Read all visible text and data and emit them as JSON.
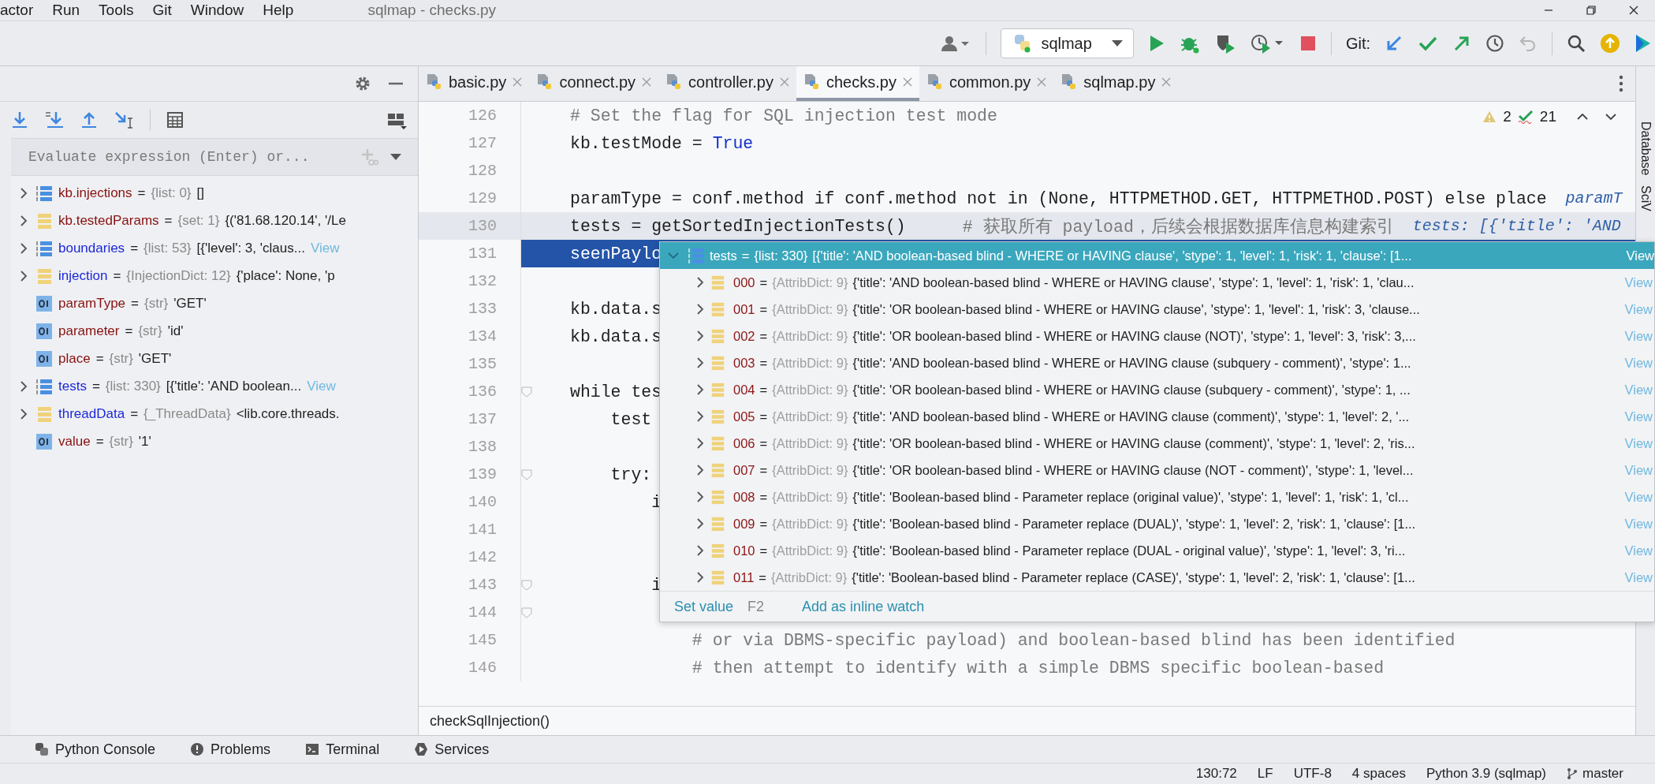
{
  "menu_bar": {
    "items": [
      "actor",
      "Run",
      "Tools",
      "Git",
      "Window",
      "Help"
    ],
    "title": "sqlmap - checks.py"
  },
  "toolbar": {
    "run_config": "sqlmap",
    "git_label": "Git:"
  },
  "debugger": {
    "evaluate_placeholder": "Evaluate expression (Enter) or...",
    "variables": [
      {
        "name": "kb.injections",
        "sep": "=",
        "type": "{list: 0}",
        "value": "[]",
        "kind": "list",
        "expandable": true,
        "changed": false
      },
      {
        "name": "kb.testedParams",
        "sep": "=",
        "type": "{set: 1}",
        "value": "{('81.68.120.14', '/Le",
        "kind": "dict",
        "expandable": true,
        "changed": false
      },
      {
        "name": "boundaries",
        "sep": "=",
        "type": "{list: 53}",
        "value": "[{'level': 3, 'claus...",
        "link": "View",
        "kind": "list",
        "expandable": true,
        "changed": true
      },
      {
        "name": "injection",
        "sep": "=",
        "type": "{InjectionDict: 12}",
        "value": "{'place': None, 'p",
        "kind": "dict",
        "expandable": true,
        "changed": true
      },
      {
        "name": "paramType",
        "sep": "=",
        "type": "{str}",
        "value": "'GET'",
        "kind": "str",
        "expandable": false,
        "changed": false
      },
      {
        "name": "parameter",
        "sep": "=",
        "type": "{str}",
        "value": "'id'",
        "kind": "str",
        "expandable": false,
        "changed": false
      },
      {
        "name": "place",
        "sep": "=",
        "type": "{str}",
        "value": "'GET'",
        "kind": "str",
        "expandable": false,
        "changed": false
      },
      {
        "name": "tests",
        "sep": "=",
        "type": "{list: 330}",
        "value": "[{'title': 'AND boolean...",
        "link": "View",
        "kind": "list",
        "expandable": true,
        "changed": true
      },
      {
        "name": "threadData",
        "sep": "=",
        "type": "{_ThreadData}",
        "value": "<lib.core.threads.",
        "kind": "dict",
        "expandable": true,
        "changed": true
      },
      {
        "name": "value",
        "sep": "=",
        "type": "{str}",
        "value": "'1'",
        "kind": "str",
        "expandable": false,
        "changed": false
      }
    ]
  },
  "editor": {
    "tabs": [
      {
        "label": "basic.py",
        "selected": false
      },
      {
        "label": "connect.py",
        "selected": false
      },
      {
        "label": "controller.py",
        "selected": false
      },
      {
        "label": "checks.py",
        "selected": true
      },
      {
        "label": "common.py",
        "selected": false
      },
      {
        "label": "sqlmap.py",
        "selected": false
      }
    ],
    "inspections": {
      "warnings": "2",
      "checks": "21"
    },
    "lines": [
      {
        "number": "126",
        "segments": [
          {
            "kind": "comment",
            "text": "# Set the flag for SQL injection test mode"
          }
        ],
        "current": false,
        "selected": false,
        "fold": false
      },
      {
        "number": "127",
        "segments": [
          {
            "kind": "code",
            "text": "kb.testMode = "
          },
          {
            "kind": "const",
            "text": "True"
          }
        ],
        "current": false,
        "selected": false,
        "fold": false
      },
      {
        "number": "128",
        "current": false,
        "selected": false,
        "fold": false
      },
      {
        "number": "129",
        "segments": [
          {
            "kind": "code",
            "text": "paramType = conf.method if conf.method not in (None, HTTPMETHOD.GET, HTTPMETHOD.POST) else place"
          },
          {
            "kind": "hint",
            "text": "paramT"
          }
        ],
        "current": false,
        "selected": false,
        "fold": false
      },
      {
        "number": "130",
        "segments": [
          {
            "kind": "code",
            "text": "tests = getSortedInjectionTests()"
          },
          {
            "kind": "comment",
            "text": "# 获取所有 payload，后续会根据数据库信息构建索引"
          },
          {
            "kind": "hint",
            "text": "tests: [{'title': 'AND"
          }
        ],
        "current": true,
        "selected": false,
        "fold": false
      },
      {
        "number": "131",
        "segments": [
          {
            "kind": "code",
            "text": "seenPaylo"
          }
        ],
        "current": false,
        "selected": true,
        "fold": false
      },
      {
        "number": "132",
        "current": false,
        "selected": false,
        "fold": false
      },
      {
        "number": "133",
        "segments": [
          {
            "kind": "code",
            "text": "kb.data.s"
          }
        ],
        "current": false,
        "selected": false,
        "fold": false
      },
      {
        "number": "134",
        "segments": [
          {
            "kind": "code",
            "text": "kb.data.s"
          }
        ],
        "current": false,
        "selected": false,
        "fold": false
      },
      {
        "number": "135",
        "current": false,
        "selected": false,
        "fold": false
      },
      {
        "number": "136",
        "segments": [
          {
            "kind": "code",
            "text": "while tes"
          }
        ],
        "current": false,
        "selected": false,
        "fold": true
      },
      {
        "number": "137",
        "segments": [
          {
            "kind": "code",
            "text": "    test"
          }
        ],
        "current": false,
        "selected": false,
        "fold": false
      },
      {
        "number": "138",
        "current": false,
        "selected": false,
        "fold": false
      },
      {
        "number": "139",
        "segments": [
          {
            "kind": "code",
            "text": "    try:"
          }
        ],
        "current": false,
        "selected": false,
        "fold": true
      },
      {
        "number": "140",
        "segments": [
          {
            "kind": "code",
            "text": "        i"
          }
        ],
        "current": false,
        "selected": false,
        "fold": false
      },
      {
        "number": "141",
        "current": false,
        "selected": false,
        "fold": false
      },
      {
        "number": "142",
        "current": false,
        "selected": false,
        "fold": false
      },
      {
        "number": "143",
        "segments": [
          {
            "kind": "code",
            "text": "        i"
          }
        ],
        "current": false,
        "selected": false,
        "fold": true
      },
      {
        "number": "144",
        "current": false,
        "selected": false,
        "fold": true
      },
      {
        "number": "145",
        "segments": [
          {
            "kind": "comment",
            "text": "            # or via DBMS-specific payload) and boolean-based blind has been identified"
          }
        ],
        "current": false,
        "selected": false,
        "fold": false
      },
      {
        "number": "146",
        "segments": [
          {
            "kind": "comment",
            "text": "            # then attempt to identify with a simple DBMS specific boolean-based"
          }
        ],
        "current": false,
        "selected": false,
        "fold": false
      }
    ],
    "breadcrumb": "checkSqlInjection()"
  },
  "debug_popup": {
    "header": {
      "name": "tests",
      "sep": "=",
      "type": "{list: 330}",
      "value": "[{'title': 'AND boolean-based blind - WHERE or HAVING clause', 'stype': 1, 'level': 1, 'risk': 1, 'clause': [1...",
      "link": "View",
      "expanded": true
    },
    "items": [
      {
        "index": "000",
        "sep": "=",
        "type": "{AttribDict: 9}",
        "value": "{'title': 'AND boolean-based blind - WHERE or HAVING clause', 'stype': 1, 'level': 1, 'risk': 1, 'clau...",
        "link": "View"
      },
      {
        "index": "001",
        "sep": "=",
        "type": "{AttribDict: 9}",
        "value": "{'title': 'OR boolean-based blind - WHERE or HAVING clause', 'stype': 1, 'level': 1, 'risk': 3, 'clause...",
        "link": "View"
      },
      {
        "index": "002",
        "sep": "=",
        "type": "{AttribDict: 9}",
        "value": "{'title': 'OR boolean-based blind - WHERE or HAVING clause (NOT)', 'stype': 1, 'level': 3, 'risk': 3,...",
        "link": "View"
      },
      {
        "index": "003",
        "sep": "=",
        "type": "{AttribDict: 9}",
        "value": "{'title': 'AND boolean-based blind - WHERE or HAVING clause (subquery - comment)', 'stype': 1...",
        "link": "View"
      },
      {
        "index": "004",
        "sep": "=",
        "type": "{AttribDict: 9}",
        "value": "{'title': 'OR boolean-based blind - WHERE or HAVING clause (subquery - comment)', 'stype': 1, ...",
        "link": "View"
      },
      {
        "index": "005",
        "sep": "=",
        "type": "{AttribDict: 9}",
        "value": "{'title': 'AND boolean-based blind - WHERE or HAVING clause (comment)', 'stype': 1, 'level': 2, '...",
        "link": "View"
      },
      {
        "index": "006",
        "sep": "=",
        "type": "{AttribDict: 9}",
        "value": "{'title': 'OR boolean-based blind - WHERE or HAVING clause (comment)', 'stype': 1, 'level': 2, 'ris...",
        "link": "View"
      },
      {
        "index": "007",
        "sep": "=",
        "type": "{AttribDict: 9}",
        "value": "{'title': 'OR boolean-based blind - WHERE or HAVING clause (NOT - comment)', 'stype': 1, 'level...",
        "link": "View"
      },
      {
        "index": "008",
        "sep": "=",
        "type": "{AttribDict: 9}",
        "value": "{'title': 'Boolean-based blind - Parameter replace (original value)', 'stype': 1, 'level': 1, 'risk': 1, 'cl...",
        "link": "View"
      },
      {
        "index": "009",
        "sep": "=",
        "type": "{AttribDict: 9}",
        "value": "{'title': 'Boolean-based blind - Parameter replace (DUAL)', 'stype': 1, 'level': 2, 'risk': 1, 'clause': [1...",
        "link": "View"
      },
      {
        "index": "010",
        "sep": "=",
        "type": "{AttribDict: 9}",
        "value": "{'title': 'Boolean-based blind - Parameter replace (DUAL - original value)', 'stype': 1, 'level': 3, 'ri...",
        "link": "View"
      },
      {
        "index": "011",
        "sep": "=",
        "type": "{AttribDict: 9}",
        "value": "{'title': 'Boolean-based blind - Parameter replace (CASE)', 'stype': 1, 'level': 2, 'risk': 1, 'clause': [1...",
        "link": "View"
      }
    ],
    "actions": [
      {
        "label": "Set value",
        "shortcut": "F2"
      },
      {
        "label": "Add as inline watch"
      }
    ]
  },
  "tool_windows": [
    {
      "label": "Python Console",
      "kind": "python"
    },
    {
      "label": "Problems",
      "kind": "problems"
    },
    {
      "label": "Terminal",
      "kind": "terminal"
    },
    {
      "label": "Services",
      "kind": "services"
    }
  ],
  "right_strip": [
    "Database",
    "SciV"
  ],
  "status_bar": [
    {
      "text": "130:72",
      "kind": "text"
    },
    {
      "text": "LF",
      "kind": "text"
    },
    {
      "text": "UTF-8",
      "kind": "text"
    },
    {
      "text": "4 spaces",
      "kind": "text"
    },
    {
      "text": "Python 3.9 (sqlmap)",
      "kind": "text"
    },
    {
      "text": "master",
      "kind": "branch"
    }
  ]
}
